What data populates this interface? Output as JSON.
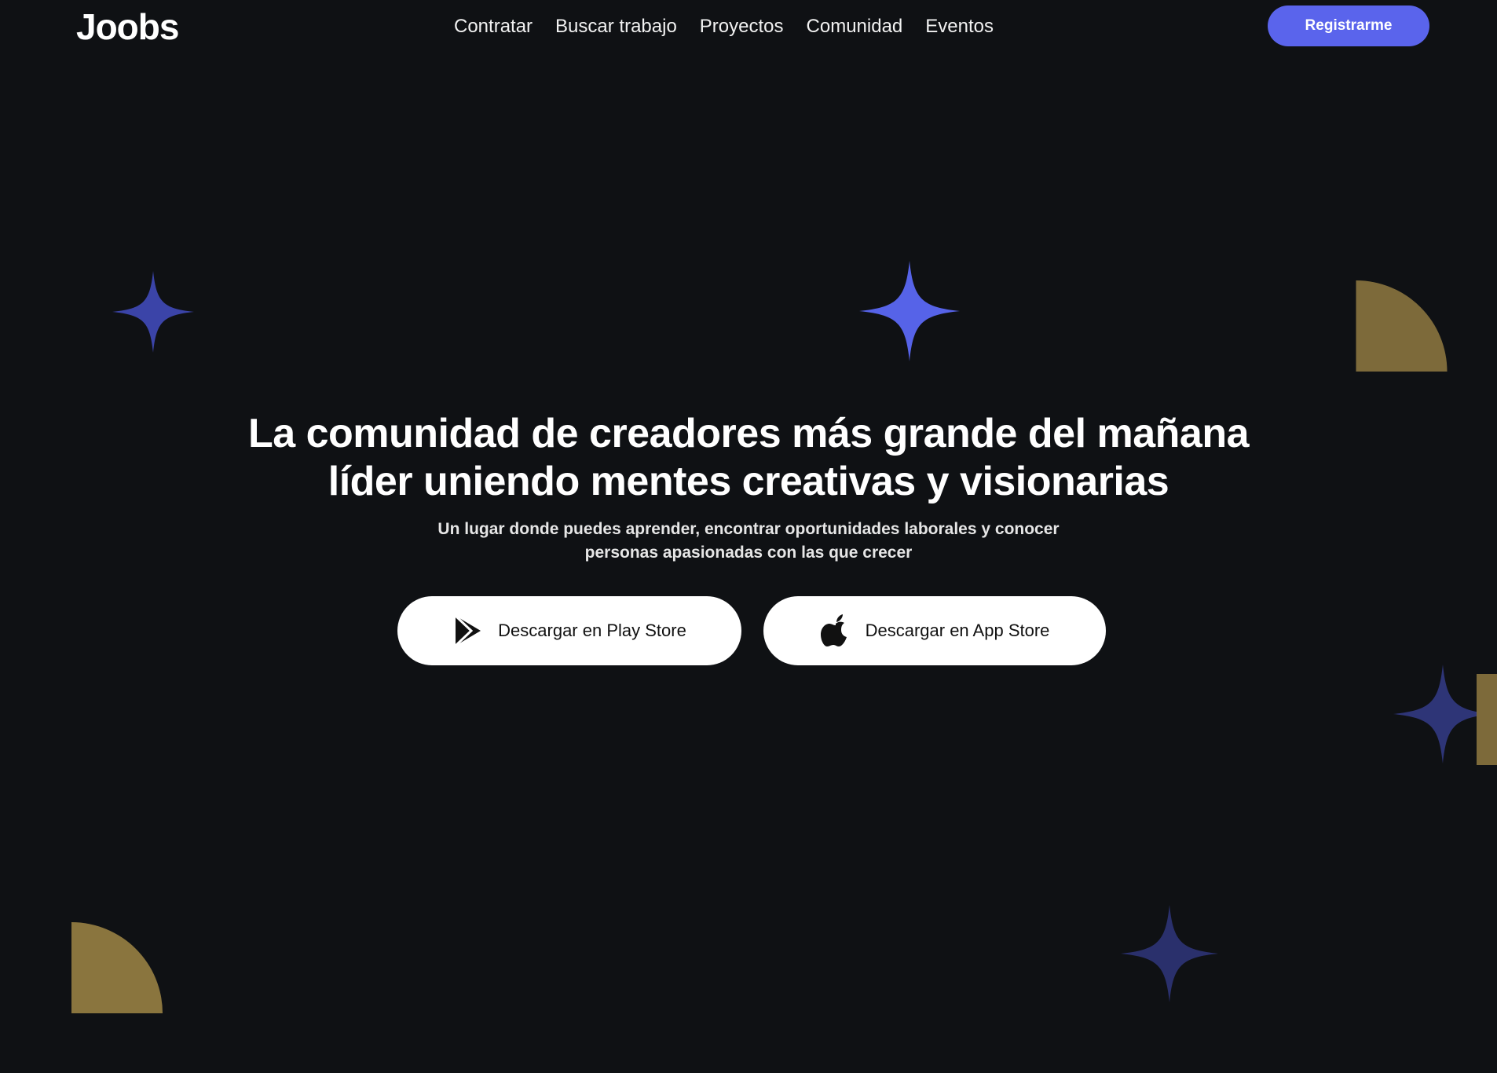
{
  "header": {
    "logo": "Joobs",
    "nav": [
      {
        "label": "Contratar"
      },
      {
        "label": "Buscar trabajo"
      },
      {
        "label": "Proyectos"
      },
      {
        "label": "Comunidad"
      },
      {
        "label": "Eventos"
      }
    ],
    "register_label": "Registrarme"
  },
  "hero": {
    "title_line1": "La comunidad de creadores más grande del mañana",
    "title_line2": "líder uniendo mentes creativas y visionarias",
    "subtitle_line1": "Un lugar donde puedes aprender, encontrar oportunidades laborales y conocer",
    "subtitle_line2": "personas apasionadas con las que crecer",
    "buttons": {
      "play_store": "Descargar en Play Store",
      "app_store": "Descargar en App Store"
    }
  },
  "icons": {
    "play_store": "play-store-icon",
    "app_store": "apple-icon",
    "decorations": [
      "sparkle-star",
      "quarter-circle"
    ]
  },
  "colors": {
    "background": "#0f1114",
    "accent": "#5a64ec",
    "star_bright": "#5663e8",
    "star_dim": "#2e3577",
    "gold": "#7d6a3a",
    "button_bg": "#ffffff"
  }
}
